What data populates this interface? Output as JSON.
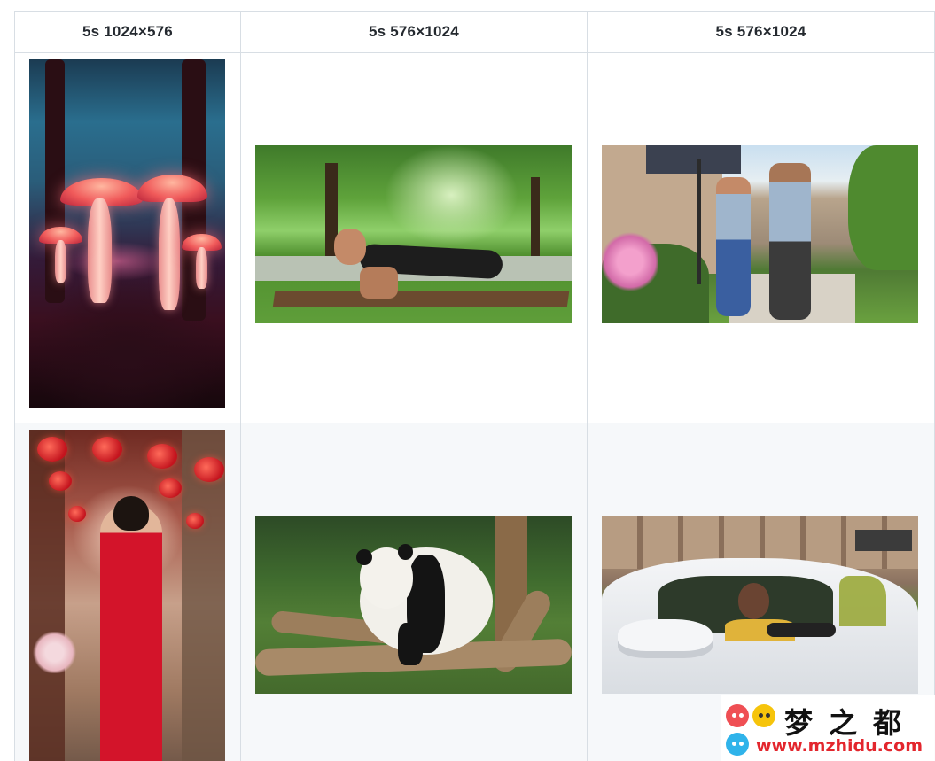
{
  "table": {
    "headers": [
      "5s 1024×576",
      "5s 576×1024",
      "5s 576×1024"
    ],
    "rows": [
      {
        "cells": [
          {
            "image": "glowing-mushroom-forest-image",
            "orientation": "portrait"
          },
          {
            "image": "man-pushup-on-bench-park-image",
            "orientation": "landscape"
          },
          {
            "image": "couple-jogging-suburban-street-image",
            "orientation": "landscape"
          }
        ]
      },
      {
        "cells": [
          {
            "image": "woman-red-qipao-lantern-street-image",
            "orientation": "portrait"
          },
          {
            "image": "panda-on-logs-image",
            "orientation": "landscape"
          },
          {
            "image": "smiling-woman-driving-white-car-image",
            "orientation": "landscape"
          }
        ]
      }
    ]
  },
  "watermark": {
    "title": "梦之都",
    "url": "www.mzhidu.com",
    "colors": [
      "#ef4f54",
      "#f6c40b",
      "#2fb3ea",
      "#e3262d"
    ]
  },
  "colors": {
    "border": "#d8dee4",
    "row_alt_bg": "#f6f8fa",
    "header_text": "#24292f"
  }
}
